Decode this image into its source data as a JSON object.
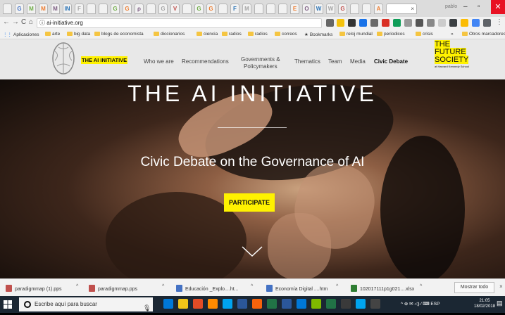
{
  "browser": {
    "tab_letters": [
      "",
      "G",
      "M",
      "M",
      "M",
      "IN",
      "F",
      "",
      "",
      "G",
      "G",
      "ρ",
      "",
      "G",
      "V",
      "",
      "G",
      "G",
      "",
      "F",
      "M",
      "",
      "",
      "",
      "E",
      "O",
      "W",
      "W",
      "G",
      "",
      "",
      "A"
    ],
    "tab_close": "×",
    "profile_label": "pablo",
    "window_controls": {
      "minimize": "–",
      "maximize": "▫",
      "close": "✕"
    },
    "nav": {
      "back": "←",
      "forward": "→",
      "reload": "C",
      "home": "⌂"
    },
    "url": "ai-initiative.org",
    "info_icon": "ⓘ"
  },
  "bookmarks": [
    {
      "label": "Aplicaciones",
      "icon": "apps-grid-icon"
    },
    {
      "label": "arte",
      "icon": "folder-icon"
    },
    {
      "label": "big data",
      "icon": "folder-icon"
    },
    {
      "label": "blogs de economista",
      "icon": "folder-icon"
    },
    {
      "label": "diccionarios",
      "icon": "folder-icon"
    },
    {
      "label": "ciencia",
      "icon": "folder-icon"
    },
    {
      "label": "radios",
      "icon": "folder-icon"
    },
    {
      "label": "radios",
      "icon": "folder-icon"
    },
    {
      "label": "correos",
      "icon": "folder-icon"
    },
    {
      "label": "Bookmarks",
      "icon": "star-icon"
    },
    {
      "label": "reloj mundial",
      "icon": "folder-icon"
    },
    {
      "label": "periodicos",
      "icon": "folder-icon"
    },
    {
      "label": "crisis",
      "icon": "folder-icon"
    }
  ],
  "bookmarks_more": "»",
  "bookmarks_other": "Otros marcadores",
  "site": {
    "brand": "THE AI INITIATIVE",
    "nav": [
      {
        "label": "Who we are"
      },
      {
        "label": "Recommendations"
      },
      {
        "label": "Governments &\nPolicymakers"
      },
      {
        "label": "Thematics"
      },
      {
        "label": "Team"
      },
      {
        "label": "Media"
      },
      {
        "label": "Civic Debate"
      }
    ],
    "partner": {
      "line1": "THE",
      "line2": "FUTURE",
      "line3": "SOCIETY",
      "tagline": "at Harvard Kennedy School"
    }
  },
  "hero": {
    "title": "THE AI INITIATIVE",
    "subtitle": "Civic Debate on the Governance of AI",
    "cta": "PARTICIPATE"
  },
  "downloads": {
    "items": [
      {
        "name": "paradigmmap (1).pps",
        "color": "#c0504d"
      },
      {
        "name": "paradigmmap.pps",
        "color": "#c0504d"
      },
      {
        "name": "Educación _Explo....ht...",
        "color": "#4472c4"
      },
      {
        "name": "Economía Digital ....htm",
        "color": "#4472c4"
      },
      {
        "name": "102017111p1g021....xlsx",
        "color": "#2e7d32"
      }
    ],
    "chevron": "^",
    "show_all": "Mostrar todo",
    "close": "×"
  },
  "taskbar": {
    "search_placeholder": "Escribe aquí para buscar",
    "mic_icon": "🎙",
    "apps": [
      "#0078d7",
      "#f0c419",
      "#e34c26",
      "#ff8c00",
      "#00a4ef",
      "#2b579a",
      "#f7630c",
      "#217346",
      "#2b579a",
      "#0078d7",
      "#7fba00",
      "#217346",
      "#3a3a3a",
      "#00a4ef",
      "#444444"
    ],
    "tray_text": "^ ⊕ ✉ ◁) ⁄ ⌨ ESP",
    "time": "21:05",
    "date": "18/02/2018",
    "notification_icon": "▤"
  }
}
